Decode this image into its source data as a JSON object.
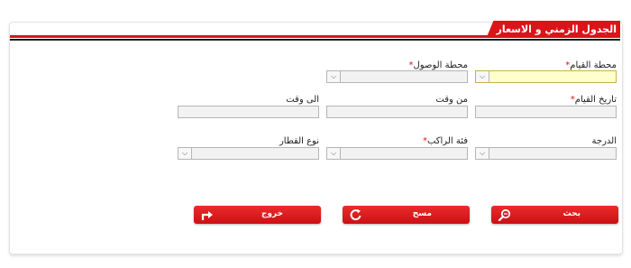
{
  "header": {
    "title": "الجدول الزمني و الاسعار"
  },
  "form": {
    "departure_station": {
      "label": "محطة القيام",
      "required": "*"
    },
    "arrival_station": {
      "label": "محطة الوصول",
      "required": "*"
    },
    "departure_date": {
      "label": "تاريخ القيام",
      "required": "*"
    },
    "from_time": {
      "label": "من وقت"
    },
    "to_time": {
      "label": "الى وقت"
    },
    "class": {
      "label": "الدرجة"
    },
    "passenger_category": {
      "label": "فئة الراكب",
      "required": "*"
    },
    "train_type": {
      "label": "نوع القطار"
    }
  },
  "buttons": {
    "search": "بحث",
    "clear": "مسح",
    "exit": "خروج"
  },
  "icons": {
    "dropdown": "chevron-down-icon"
  },
  "colors": {
    "accent": "#d9151b",
    "focus_field": "#ffffcc"
  }
}
